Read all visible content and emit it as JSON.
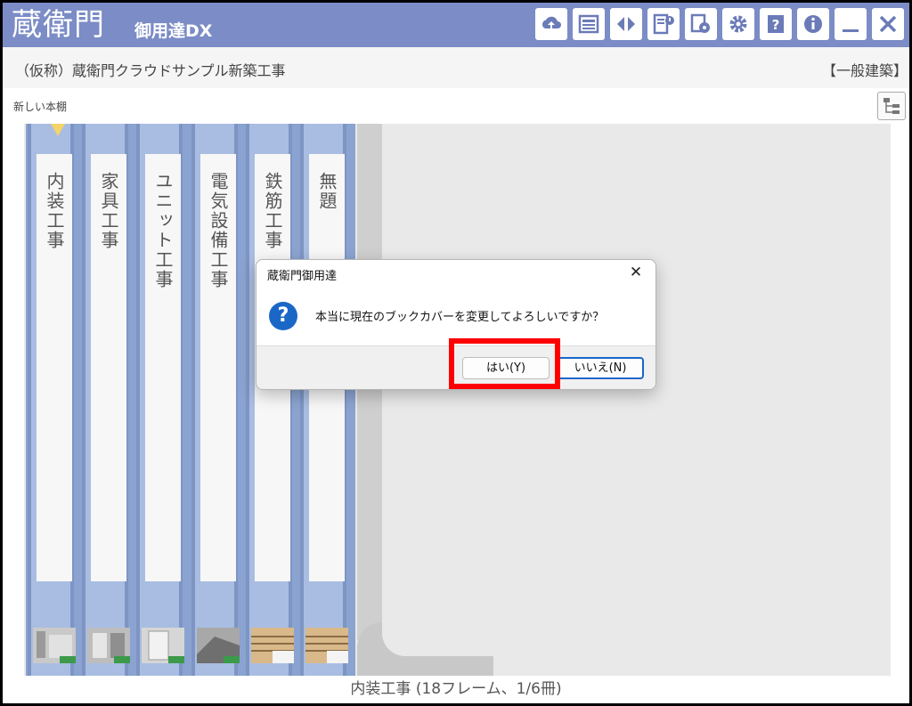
{
  "app": {
    "logo_text": "蔵衛門",
    "sub_text": "御用達DX",
    "toolbar_icons": [
      "cloud-upload-icon",
      "board-icon",
      "split-icon",
      "album-info-icon",
      "disc-settings-icon",
      "gear-icon",
      "help-icon",
      "info-icon",
      "minimize-icon",
      "close-icon"
    ],
    "colors": {
      "titlebar": "#7b8cc6",
      "shelf": "#8aa3d0",
      "highlight": "#ff0000",
      "accent": "#1a66c9"
    }
  },
  "project": {
    "title": "（仮称）蔵衛門クラウドサンプル新築工事",
    "type": "【一般建築】"
  },
  "shelf": {
    "label": "新しい本棚",
    "books": [
      {
        "title": "内装工事"
      },
      {
        "title": "家具工事"
      },
      {
        "title": "ユニット工事"
      },
      {
        "title": "電気設備工事"
      },
      {
        "title": "鉄筋工事"
      },
      {
        "title": "無題"
      }
    ]
  },
  "status": {
    "text": "内装工事 (18フレーム、1/6冊)"
  },
  "dialog": {
    "title": "蔵衛門御用達",
    "message": "本当に現在のブックカバーを変更してよろしいですか？",
    "yes_label": "はい(Y)",
    "no_label": "いいえ(N)"
  }
}
